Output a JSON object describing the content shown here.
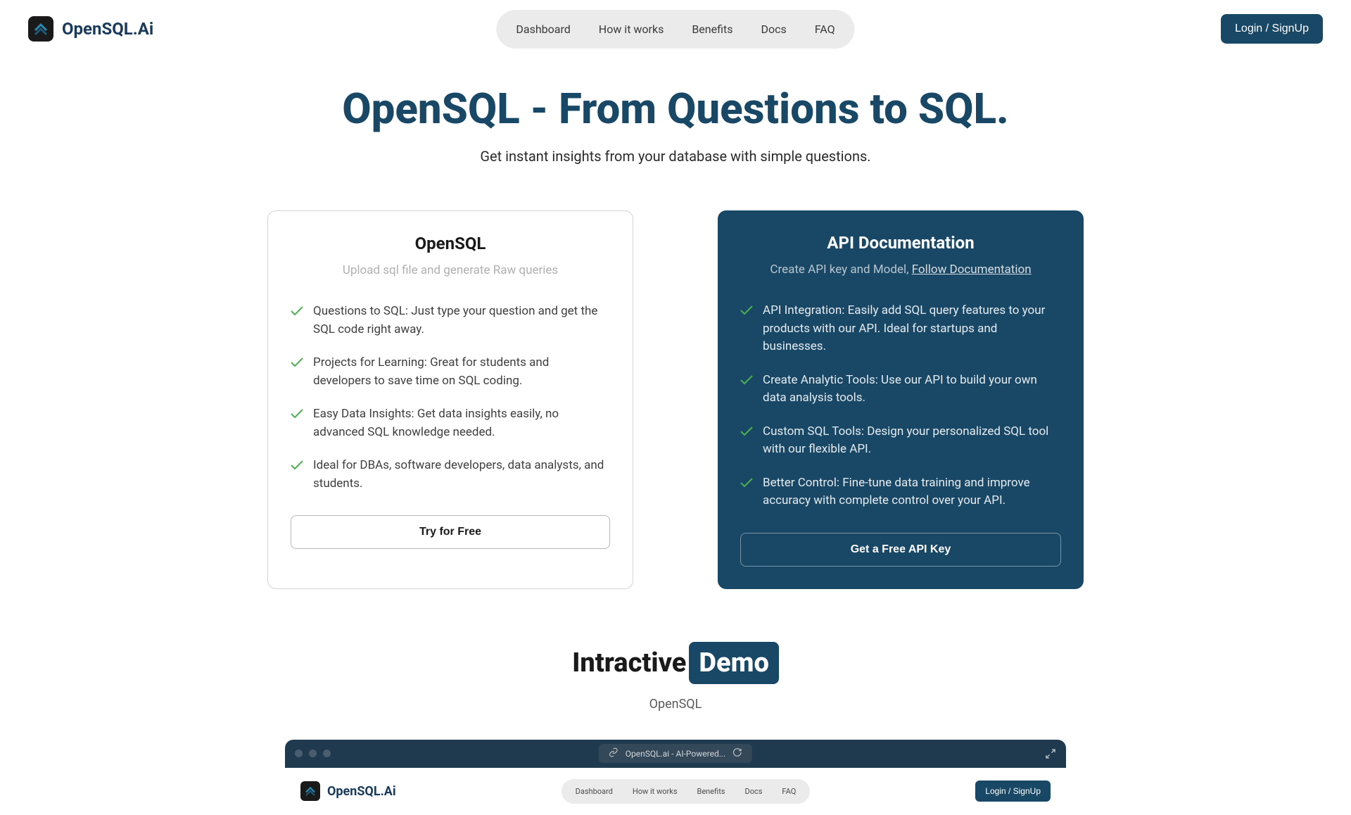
{
  "brand": {
    "name": "OpenSQL.Ai"
  },
  "nav": {
    "items": [
      "Dashboard",
      "How it works",
      "Benefits",
      "Docs",
      "FAQ"
    ]
  },
  "header": {
    "login_label": "Login / SignUp"
  },
  "hero": {
    "title": "OpenSQL - From Questions to SQL.",
    "subtitle": "Get instant insights from your database with simple questions."
  },
  "cards": {
    "opensql": {
      "title": "OpenSQL",
      "subtitle": "Upload sql file and generate Raw queries",
      "features": [
        "Questions to SQL: Just type your question and get the SQL code right away.",
        "Projects for Learning: Great for students and developers to save time on SQL coding.",
        "Easy Data Insights: Get data insights easily, no advanced SQL knowledge needed.",
        "Ideal for DBAs, software developers, data analysts, and students."
      ],
      "button": "Try for Free"
    },
    "apidocs": {
      "title": "API Documentation",
      "subtitle_prefix": "Create API key and Model, ",
      "subtitle_link": "Follow Documentation",
      "features": [
        "API Integration: Easily add SQL query features to your products with our API. Ideal for startups and businesses.",
        "Create Analytic Tools: Use our API to build your own data analysis tools.",
        "Custom SQL Tools: Design your personalized SQL tool with our flexible API.",
        "Better Control: Fine-tune data training and improve accuracy with complete control over your API."
      ],
      "button": "Get a Free API Key"
    }
  },
  "demo": {
    "title_prefix": "Intractive",
    "title_badge": "Demo",
    "subtitle": "OpenSQL",
    "url": "OpenSQL.ai - AI-Powered...",
    "mini_brand": "OpenSQL.Ai",
    "mini_nav": [
      "Dashboard",
      "How it works",
      "Benefits",
      "Docs",
      "FAQ"
    ],
    "mini_login": "Login / SignUp"
  }
}
